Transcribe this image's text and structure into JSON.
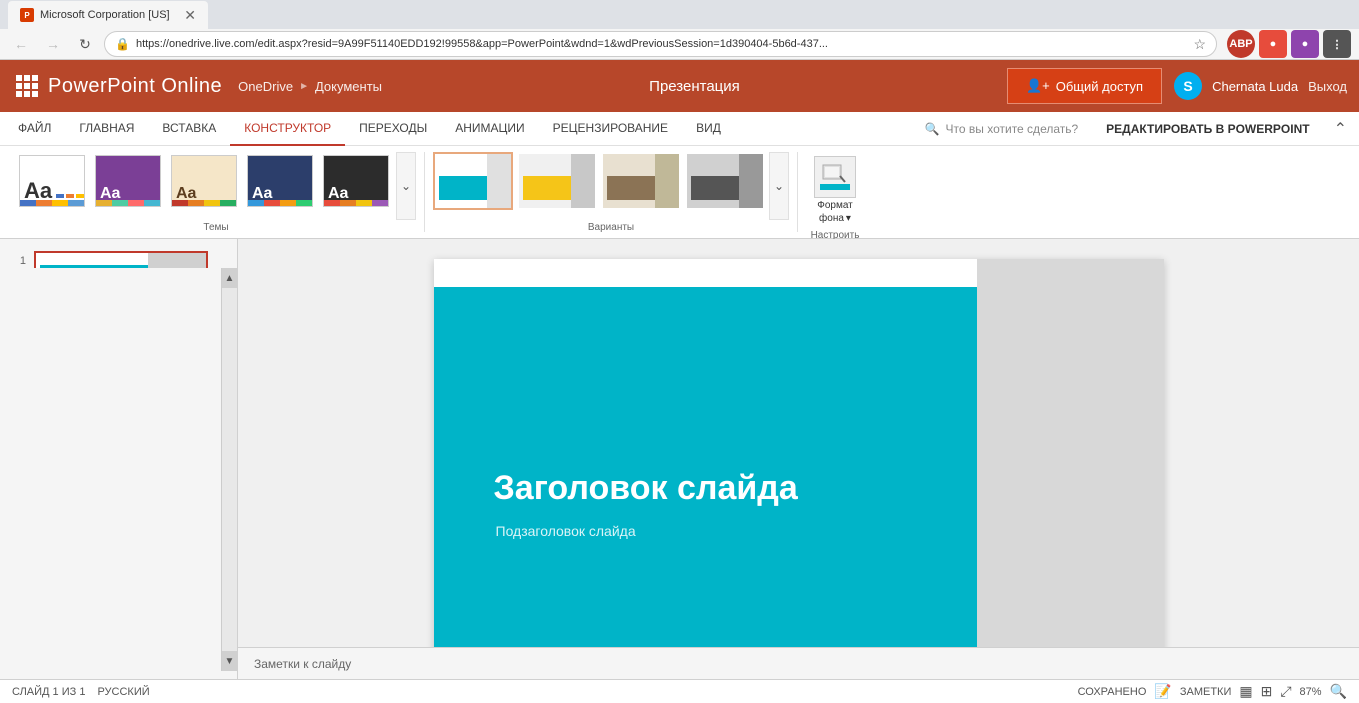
{
  "browser": {
    "tab_title": "Microsoft Corporation [US]",
    "url": "https://onedrive.live.com/edit.aspx?resid=9A99F51140EDD192!99558&app=PowerPoint&wdnd=1&wdPreviousSession=1d390404-5b6d-437...",
    "favicon_letter": "P"
  },
  "topbar": {
    "app_name": "PowerPoint Online",
    "breadcrumb_home": "OneDrive",
    "breadcrumb_sep": "▶",
    "breadcrumb_folder": "Документы",
    "doc_title": "Презентация",
    "share_btn_label": "Общий доступ",
    "user_name": "Chernata Luda",
    "sign_out_label": "Выход",
    "skype_letter": "S"
  },
  "ribbon": {
    "tabs": [
      {
        "id": "file",
        "label": "ФАЙЛ"
      },
      {
        "id": "home",
        "label": "ГЛАВНАЯ"
      },
      {
        "id": "insert",
        "label": "ВСТАВКА"
      },
      {
        "id": "design",
        "label": "КОНСТРУКТОР"
      },
      {
        "id": "transitions",
        "label": "ПЕРЕХОДЫ"
      },
      {
        "id": "animations",
        "label": "АНИМАЦИИ"
      },
      {
        "id": "review",
        "label": "РЕЦЕНЗИРОВАНИЕ"
      },
      {
        "id": "view",
        "label": "ВИД"
      }
    ],
    "search_placeholder": "Что вы хотите сделать?",
    "edit_in_pp_label": "РЕДАКТИРОВАТЬ В POWERPOINT",
    "themes_label": "Темы",
    "variants_label": "Варианты",
    "customize_label": "Настроить",
    "format_bg_label": "Формат",
    "format_bg_line2": "фона",
    "format_bg_arrow": "▾"
  },
  "themes": [
    {
      "id": "default",
      "bg": "#ffffff"
    },
    {
      "id": "colorful",
      "bg": "#7b3f96"
    },
    {
      "id": "office-theme",
      "bg": "#f5e6c8"
    },
    {
      "id": "dark-blue",
      "bg": "#1a237e"
    },
    {
      "id": "dark-gray",
      "bg": "#2c2c2c"
    }
  ],
  "variants": [
    {
      "id": "v1",
      "selected": true,
      "colors": [
        "#00b4c8",
        "#d0d0d0",
        "#ffffff"
      ]
    },
    {
      "id": "v2",
      "colors": [
        "#f5c518",
        "#888",
        "#ffffff"
      ]
    },
    {
      "id": "v3",
      "colors": [
        "#8b7355",
        "#c8c0a0",
        "#ffffff"
      ]
    },
    {
      "id": "v4",
      "colors": [
        "#555",
        "#888",
        "#ffffff"
      ]
    }
  ],
  "slide": {
    "number": "1",
    "title_text": "Заголовок слайда",
    "subtitle_text": "Подзаголовок слайда",
    "notes_placeholder": "Заметки к слайду"
  },
  "statusbar": {
    "slide_info": "СЛАЙД 1 ИЗ 1",
    "language": "РУССКИЙ",
    "save_status": "СОХРАНЕНО",
    "notes_label": "ЗАМЕТКИ",
    "zoom_level": "87%"
  }
}
